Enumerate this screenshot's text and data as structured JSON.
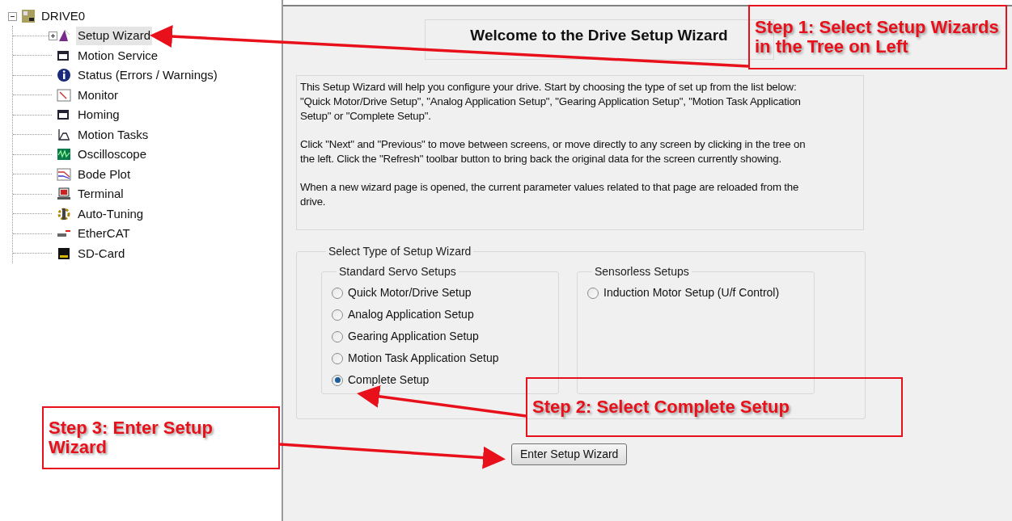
{
  "tree": {
    "label": "DRIVE0",
    "expanded": true,
    "children": [
      {
        "label": "Setup Wizard",
        "selected": true,
        "expanded": false
      },
      {
        "label": "Motion Service",
        "selected": false
      },
      {
        "label": "Status (Errors / Warnings)",
        "selected": false
      },
      {
        "label": "Monitor",
        "selected": false
      },
      {
        "label": "Homing",
        "selected": false
      },
      {
        "label": "Motion Tasks",
        "selected": false
      },
      {
        "label": "Oscilloscope",
        "selected": false
      },
      {
        "label": "Bode Plot",
        "selected": false
      },
      {
        "label": "Terminal",
        "selected": false
      },
      {
        "label": "Auto-Tuning",
        "selected": false
      },
      {
        "label": "EtherCAT",
        "selected": false
      },
      {
        "label": "SD-Card",
        "selected": false
      }
    ]
  },
  "page": {
    "title": "Welcome to the Drive Setup Wizard",
    "description": [
      "This Setup Wizard will help you configure your drive. Start by choosing the type of set up from the list below: \"Quick Motor/Drive Setup\", \"Analog Application Setup\", \"Gearing Application Setup\", \"Motion Task Application Setup\" or \"Complete Setup\".",
      "Click \"Next\" and \"Previous\" to move between screens, or move directly to any screen by clicking in the tree on the left. Click the \"Refresh\" toolbar button to bring back the original data for the screen currently showing.",
      "When a new wizard page is opened, the current parameter values related to that page are reloaded from the drive."
    ],
    "group": {
      "title": "Select Type of Setup Wizard",
      "subgroups": [
        {
          "title": "Standard Servo Setups",
          "options": [
            {
              "label": "Quick Motor/Drive Setup",
              "selected": false
            },
            {
              "label": "Analog Application Setup",
              "selected": false
            },
            {
              "label": "Gearing Application Setup",
              "selected": false
            },
            {
              "label": "Motion Task Application Setup",
              "selected": false
            },
            {
              "label": "Complete Setup",
              "selected": true
            }
          ]
        },
        {
          "title": "Sensorless Setups",
          "options": [
            {
              "label": "Induction Motor Setup (U/f Control)",
              "selected": false
            }
          ]
        }
      ]
    },
    "button": "Enter Setup Wizard"
  },
  "annotations": [
    "Step 1: Select Setup Wizards in the Tree on Left",
    "Step 2: Select Complete Setup",
    "Step 3: Enter Setup Wizard"
  ]
}
